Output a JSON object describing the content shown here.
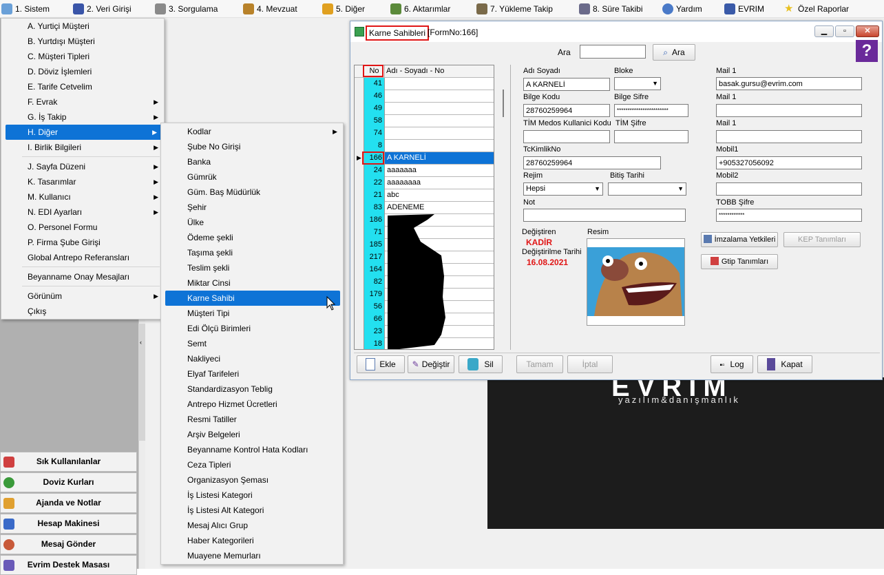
{
  "menubar": [
    {
      "label": "1.  Sistem",
      "icon": "system-icon"
    },
    {
      "label": "2.  Veri Girişi",
      "icon": "data-entry-icon"
    },
    {
      "label": "3.  Sorgulama",
      "icon": "query-icon"
    },
    {
      "label": "4.  Mevzuat",
      "icon": "books-icon"
    },
    {
      "label": "5.  Diğer",
      "icon": "other-icon"
    },
    {
      "label": "6.  Aktarımlar",
      "icon": "transfer-icon"
    },
    {
      "label": "7.  Yükleme Takip",
      "icon": "loading-icon"
    },
    {
      "label": "8. Süre Takibi",
      "icon": "timer-icon"
    },
    {
      "label": "Yardım",
      "icon": "help-icon"
    },
    {
      "label": "EVRIM",
      "icon": "evrim-icon"
    },
    {
      "label": "Özel Raporlar",
      "icon": "star-icon"
    }
  ],
  "sistem_menu": [
    {
      "label": "A.  Yurtiçi Müşteri",
      "arrow": false
    },
    {
      "label": "B.  Yurtdışı Müşteri",
      "arrow": false
    },
    {
      "label": "C.  Müşteri Tipleri",
      "arrow": false
    },
    {
      "label": "D.  Döviz İşlemleri",
      "arrow": false
    },
    {
      "label": "E.  Tarife Cetvelim",
      "arrow": false
    },
    {
      "label": "F.  Evrak",
      "arrow": true
    },
    {
      "label": "G.  İş Takip",
      "arrow": true
    },
    {
      "label": "H.  Diğer",
      "arrow": true
    },
    {
      "label": "I.  Birlik Bilgileri",
      "arrow": true
    },
    {
      "label": "J.  Sayfa Düzeni",
      "arrow": true
    },
    {
      "label": "K.  Tasarımlar",
      "arrow": true
    },
    {
      "label": "M.  Kullanıcı",
      "arrow": true
    },
    {
      "label": "N.  EDI Ayarları",
      "arrow": true
    },
    {
      "label": "O.  Personel Formu",
      "arrow": false
    },
    {
      "label": "P.  Firma Şube Girişi",
      "arrow": false
    },
    {
      "label": "Global Antrepo Referansları",
      "arrow": false
    },
    {
      "label": "Beyanname Onay Mesajları",
      "arrow": false
    },
    {
      "label": "Görünüm",
      "arrow": true
    },
    {
      "label": "Çıkış",
      "arrow": false
    }
  ],
  "diger_submenu": [
    {
      "label": "Kodlar",
      "arrow": true
    },
    {
      "label": "Şube No Girişi",
      "arrow": false
    },
    {
      "label": "Banka",
      "arrow": false
    },
    {
      "label": "Gümrük",
      "arrow": false
    },
    {
      "label": "Güm. Baş Müdürlük",
      "arrow": false
    },
    {
      "label": "Şehir",
      "arrow": false
    },
    {
      "label": "Ülke",
      "arrow": false
    },
    {
      "label": "Ödeme şekli",
      "arrow": false
    },
    {
      "label": "Taşıma şekli",
      "arrow": false
    },
    {
      "label": "Teslim şekli",
      "arrow": false
    },
    {
      "label": "Miktar Cinsi",
      "arrow": false
    },
    {
      "label": "Karne Sahibi",
      "arrow": false
    },
    {
      "label": "Müşteri  Tipi",
      "arrow": false
    },
    {
      "label": "Edi Ölçü Birimleri",
      "arrow": false
    },
    {
      "label": "Semt",
      "arrow": false
    },
    {
      "label": "Nakliyeci",
      "arrow": false
    },
    {
      "label": "Elyaf Tarifeleri",
      "arrow": false
    },
    {
      "label": "Standardizasyon Teblig",
      "arrow": false
    },
    {
      "label": "Antrepo Hizmet Ücretleri",
      "arrow": false
    },
    {
      "label": "Resmi Tatiller",
      "arrow": false
    },
    {
      "label": "Arşiv Belgeleri",
      "arrow": false
    },
    {
      "label": "Beyanname Kontrol Hata Kodları",
      "arrow": false
    },
    {
      "label": "Ceza Tipleri",
      "arrow": false
    },
    {
      "label": "Organizasyon Şeması",
      "arrow": false
    },
    {
      "label": "İş Listesi Kategori",
      "arrow": false
    },
    {
      "label": "İş Listesi Alt Kategori",
      "arrow": false
    },
    {
      "label": "Mesaj Alıcı Grup",
      "arrow": false
    },
    {
      "label": "Haber Kategorileri",
      "arrow": false
    },
    {
      "label": "Muayene Memurları",
      "arrow": false
    }
  ],
  "left_buttons": [
    {
      "label": "Sık Kullanılanlar",
      "icon": "favorites-icon"
    },
    {
      "label": "Doviz Kurları",
      "icon": "currency-icon"
    },
    {
      "label": "Ajanda ve Notlar",
      "icon": "notes-icon"
    },
    {
      "label": "Hesap Makinesi",
      "icon": "calculator-icon"
    },
    {
      "label": "Mesaj Gönder",
      "icon": "users-icon"
    },
    {
      "label": "Evrim Destek Masası",
      "icon": "support-icon"
    }
  ],
  "logo": {
    "big": "EVRIM",
    "sub": "yazılım&danışmanlık"
  },
  "window": {
    "title": "Karne Sahibleri",
    "formno": "[FormNo:166]",
    "search_label": "Ara",
    "search_button": "Ara",
    "help_glyph": "?",
    "grid": {
      "col_no": "No",
      "col_name": "Adı - Soyadı - No",
      "rows": [
        {
          "no": "41",
          "name": ""
        },
        {
          "no": "46",
          "name": ""
        },
        {
          "no": "49",
          "name": ""
        },
        {
          "no": "58",
          "name": ""
        },
        {
          "no": "74",
          "name": ""
        },
        {
          "no": "8",
          "name": ""
        },
        {
          "no": "166",
          "name": "A KARNELİ"
        },
        {
          "no": "24",
          "name": "aaaaaaa"
        },
        {
          "no": "22",
          "name": "aaaaaaaa"
        },
        {
          "no": "21",
          "name": "abc"
        },
        {
          "no": "83",
          "name": "ADENEME"
        },
        {
          "no": "186",
          "name": ""
        },
        {
          "no": "71",
          "name": ""
        },
        {
          "no": "185",
          "name": ""
        },
        {
          "no": "217",
          "name": ""
        },
        {
          "no": "164",
          "name": ""
        },
        {
          "no": "82",
          "name": ""
        },
        {
          "no": "179",
          "name": ""
        },
        {
          "no": "56",
          "name": ""
        },
        {
          "no": "66",
          "name": ""
        },
        {
          "no": "23",
          "name": ""
        },
        {
          "no": "18",
          "name": ""
        }
      ],
      "selected_index": 6
    },
    "form": {
      "adi_soyadi_label": "Adı Soyadı",
      "adi_soyadi": "A KARNELİ",
      "bloke_label": "Bloke",
      "bloke": "",
      "mail1_label": "Mail 1",
      "mail1": "basak.gursu@evrim.com",
      "bilge_kodu_label": "Bilge Kodu",
      "bilge_kodu": "28760259964",
      "bilge_sifre_label": "Bilge Sifre",
      "bilge_sifre": "************************",
      "mail2_label": "Mail 1",
      "mail2": "",
      "tim_kodu_label": "TİM Medos Kullanici Kodu",
      "tim_kodu": "",
      "tim_sifre_label": "TİM Şifre",
      "tim_sifre": "",
      "mail3_label": "Mail 1",
      "mail3": "",
      "tckimlik_label": "TcKimlikNo",
      "tckimlik": "28760259964",
      "mobil1_label": "Mobil1",
      "mobil1": "+905327056092",
      "rejim_label": "Rejim",
      "rejim": "Hepsi",
      "bitis_label": "Bitiş Tarihi",
      "bitis": "",
      "mobil2_label": "Mobil2",
      "mobil2": "",
      "not_label": "Not",
      "not": "",
      "tobb_label": "TOBB Şifre",
      "tobb": "************",
      "degistiren_label": "Değiştiren",
      "degistiren": "KADİR",
      "degistirilme_label": "Değiştirilme Tarihi",
      "degistirilme": "16.08.2021",
      "resim_label": "Resim",
      "imzalama_button": "İmzalama Yetkileri",
      "kep_button": "KEP Tanımları",
      "gtip_button": "Gtip Tanımları"
    },
    "bottom_buttons": {
      "ekle": "Ekle",
      "degistir": "Değiştir",
      "sil": "Sil",
      "tamam": "Tamam",
      "iptal": "İptal",
      "log": "Log",
      "kapat": "Kapat"
    }
  },
  "colors": {
    "accent": "#0e73d6",
    "grid_no": "#23e0f0",
    "highlight_box": "#e01515",
    "changed_by": "#e01515"
  }
}
